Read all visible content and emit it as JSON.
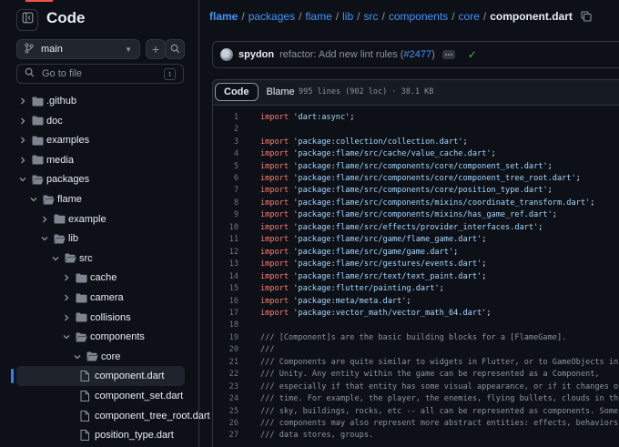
{
  "sidebar": {
    "title": "Code",
    "branch": "main",
    "goto_placeholder": "Go to file",
    "goto_shortcut": "t",
    "tree": [
      {
        "name": ".github",
        "type": "dir",
        "depth": 0,
        "open": false
      },
      {
        "name": "doc",
        "type": "dir",
        "depth": 0,
        "open": false
      },
      {
        "name": "examples",
        "type": "dir",
        "depth": 0,
        "open": false
      },
      {
        "name": "media",
        "type": "dir",
        "depth": 0,
        "open": false
      },
      {
        "name": "packages",
        "type": "dir",
        "depth": 0,
        "open": true
      },
      {
        "name": "flame",
        "type": "dir",
        "depth": 1,
        "open": true
      },
      {
        "name": "example",
        "type": "dir",
        "depth": 2,
        "open": false
      },
      {
        "name": "lib",
        "type": "dir",
        "depth": 2,
        "open": true
      },
      {
        "name": "src",
        "type": "dir",
        "depth": 3,
        "open": true
      },
      {
        "name": "cache",
        "type": "dir",
        "depth": 4,
        "open": false
      },
      {
        "name": "camera",
        "type": "dir",
        "depth": 4,
        "open": false
      },
      {
        "name": "collisions",
        "type": "dir",
        "depth": 4,
        "open": false
      },
      {
        "name": "components",
        "type": "dir",
        "depth": 4,
        "open": true
      },
      {
        "name": "core",
        "type": "dir",
        "depth": 5,
        "open": true
      },
      {
        "name": "component.dart",
        "type": "file",
        "depth": 6,
        "selected": true
      },
      {
        "name": "component_set.dart",
        "type": "file",
        "depth": 6
      },
      {
        "name": "component_tree_root.dart",
        "type": "file",
        "depth": 6
      },
      {
        "name": "position_type.dart",
        "type": "file",
        "depth": 6
      }
    ]
  },
  "breadcrumb": {
    "parts": [
      "flame",
      "packages",
      "flame",
      "lib",
      "src",
      "components",
      "core"
    ],
    "current": "component.dart"
  },
  "commit": {
    "author": "spydon",
    "message": "refactor: Add new lint rules (",
    "pr": "#2477",
    "message_end": ")"
  },
  "file": {
    "tabs": [
      "Code",
      "Blame"
    ],
    "active_tab": "Code",
    "info": "995 lines (902 loc) · 38.1 KB"
  },
  "code_lines": [
    {
      "n": "1",
      "t": "import",
      "kw": "import ",
      "s": "'dart:async'",
      "e": ";"
    },
    {
      "n": "2",
      "t": "blank"
    },
    {
      "n": "3",
      "t": "import",
      "kw": "import ",
      "s": "'package:collection/collection.dart'",
      "e": ";"
    },
    {
      "n": "4",
      "t": "import",
      "kw": "import ",
      "s": "'package:flame/src/cache/value_cache.dart'",
      "e": ";"
    },
    {
      "n": "5",
      "t": "import",
      "kw": "import ",
      "s": "'package:flame/src/components/core/component_set.dart'",
      "e": ";"
    },
    {
      "n": "6",
      "t": "import",
      "kw": "import ",
      "s": "'package:flame/src/components/core/component_tree_root.dart'",
      "e": ";"
    },
    {
      "n": "7",
      "t": "import",
      "kw": "import ",
      "s": "'package:flame/src/components/core/position_type.dart'",
      "e": ";"
    },
    {
      "n": "8",
      "t": "import",
      "kw": "import ",
      "s": "'package:flame/src/components/mixins/coordinate_transform.dart'",
      "e": ";"
    },
    {
      "n": "9",
      "t": "import",
      "kw": "import ",
      "s": "'package:flame/src/components/mixins/has_game_ref.dart'",
      "e": ";"
    },
    {
      "n": "10",
      "t": "import",
      "kw": "import ",
      "s": "'package:flame/src/effects/provider_interfaces.dart'",
      "e": ";"
    },
    {
      "n": "11",
      "t": "import",
      "kw": "import ",
      "s": "'package:flame/src/game/flame_game.dart'",
      "e": ";"
    },
    {
      "n": "12",
      "t": "import",
      "kw": "import ",
      "s": "'package:flame/src/game/game.dart'",
      "e": ";"
    },
    {
      "n": "13",
      "t": "import",
      "kw": "import ",
      "s": "'package:flame/src/gestures/events.dart'",
      "e": ";"
    },
    {
      "n": "14",
      "t": "import",
      "kw": "import ",
      "s": "'package:flame/src/text/text_paint.dart'",
      "e": ";"
    },
    {
      "n": "15",
      "t": "import",
      "kw": "import ",
      "s": "'package:flutter/painting.dart'",
      "e": ";"
    },
    {
      "n": "16",
      "t": "import",
      "kw": "import ",
      "s": "'package:meta/meta.dart'",
      "e": ";"
    },
    {
      "n": "17",
      "t": "import",
      "kw": "import ",
      "s": "'package:vector_math/vector_math_64.dart'",
      "e": ";"
    },
    {
      "n": "18",
      "t": "blank"
    },
    {
      "n": "19",
      "t": "comment",
      "c": "/// [Component]s are the basic building blocks for a [FlameGame]."
    },
    {
      "n": "20",
      "t": "comment",
      "c": "///"
    },
    {
      "n": "21",
      "t": "comment",
      "c": "/// Components are quite similar to widgets in Flutter, or to GameObjects in"
    },
    {
      "n": "22",
      "t": "comment",
      "c": "/// Unity. Any entity within the game can be represented as a Component,"
    },
    {
      "n": "23",
      "t": "comment",
      "c": "/// especially if that entity has some visual appearance, or if it changes over"
    },
    {
      "n": "24",
      "t": "comment",
      "c": "/// time. For example, the player, the enemies, flying bullets, clouds in the"
    },
    {
      "n": "25",
      "t": "comment",
      "c": "/// sky, buildings, rocks, etc -- all can be represented as components. Some"
    },
    {
      "n": "26",
      "t": "comment",
      "c": "/// components may also represent more abstract entities: effects, behaviors,"
    },
    {
      "n": "27",
      "t": "comment",
      "c": "/// data stores, groups."
    }
  ],
  "colors": {
    "background": "#0d1117",
    "link": "#4493f8",
    "keyword": "#ff7b72",
    "string": "#a5d6ff",
    "comment": "#8b949e",
    "success": "#3fb950",
    "selection_bar": "#2f81f7"
  },
  "icons": [
    "sidebar-collapse-icon",
    "git-branch-icon",
    "plus-icon",
    "search-icon",
    "chevron-right-icon",
    "chevron-down-icon",
    "folder-icon",
    "file-icon",
    "copy-icon",
    "check-icon",
    "kebab-icon"
  ]
}
